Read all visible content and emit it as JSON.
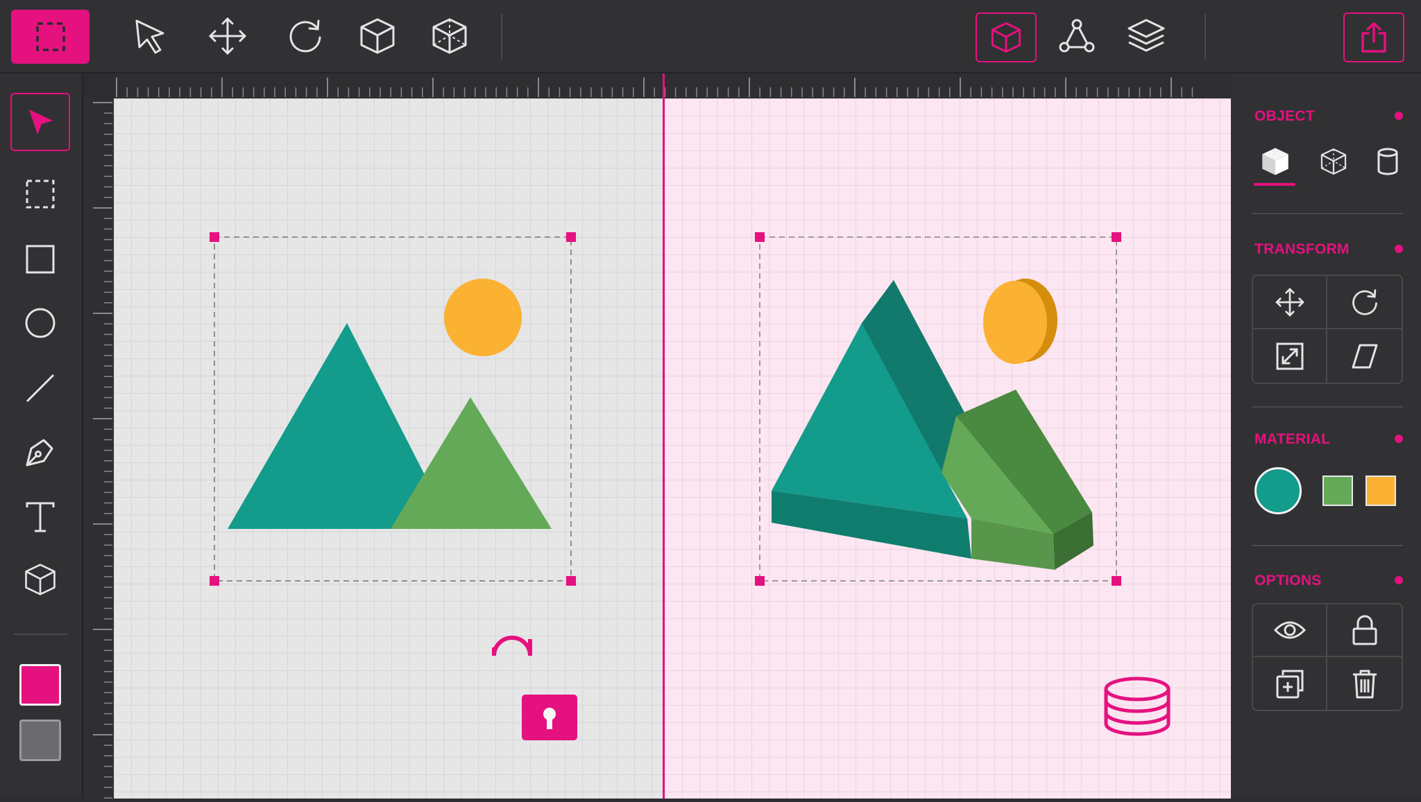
{
  "toolbar": {
    "left_tools": [
      "marquee-select-icon",
      "pointer-icon",
      "move-icon",
      "rotate-icon",
      "cube-icon",
      "wireframe-cube-icon"
    ],
    "right_tools": [
      "cube-3d-mode-icon",
      "node-graph-icon",
      "layers-icon"
    ],
    "export": "export-icon"
  },
  "left_tools": [
    "select-arrow-icon",
    "marquee-icon",
    "rectangle-icon",
    "ellipse-icon",
    "line-icon",
    "pen-icon",
    "text-icon",
    "cube-icon"
  ],
  "colors": {
    "accent": "#e5117f",
    "fill_swatch": "#e5117f",
    "stroke_swatch": "#6b6b6d",
    "teal": "#139b8b",
    "green": "#64a957",
    "orange": "#fbb131"
  },
  "panel": {
    "object": {
      "title": "OBJECT",
      "tabs": [
        "solid-cube-icon",
        "wireframe-cube-icon",
        "cylinder-icon"
      ],
      "active": 0
    },
    "transform": {
      "title": "TRANSFORM",
      "buttons": [
        "move-icon",
        "rotate-icon",
        "scale-icon",
        "skew-icon"
      ]
    },
    "material": {
      "title": "MATERIAL",
      "swatches": [
        "#139b8b",
        "#64a957",
        "#fbb131"
      ]
    },
    "options": {
      "title": "OPTIONS",
      "buttons": [
        "visibility-eye-icon",
        "lock-icon",
        "duplicate-icon",
        "delete-icon"
      ]
    }
  },
  "canvas": {
    "left_artboard": {
      "content": "flat-mountain-sun-image",
      "badge": "unlocked-padlock-icon"
    },
    "right_artboard": {
      "content": "3d-extruded-mountain-sun-image",
      "badge": "database-stack-icon"
    }
  }
}
